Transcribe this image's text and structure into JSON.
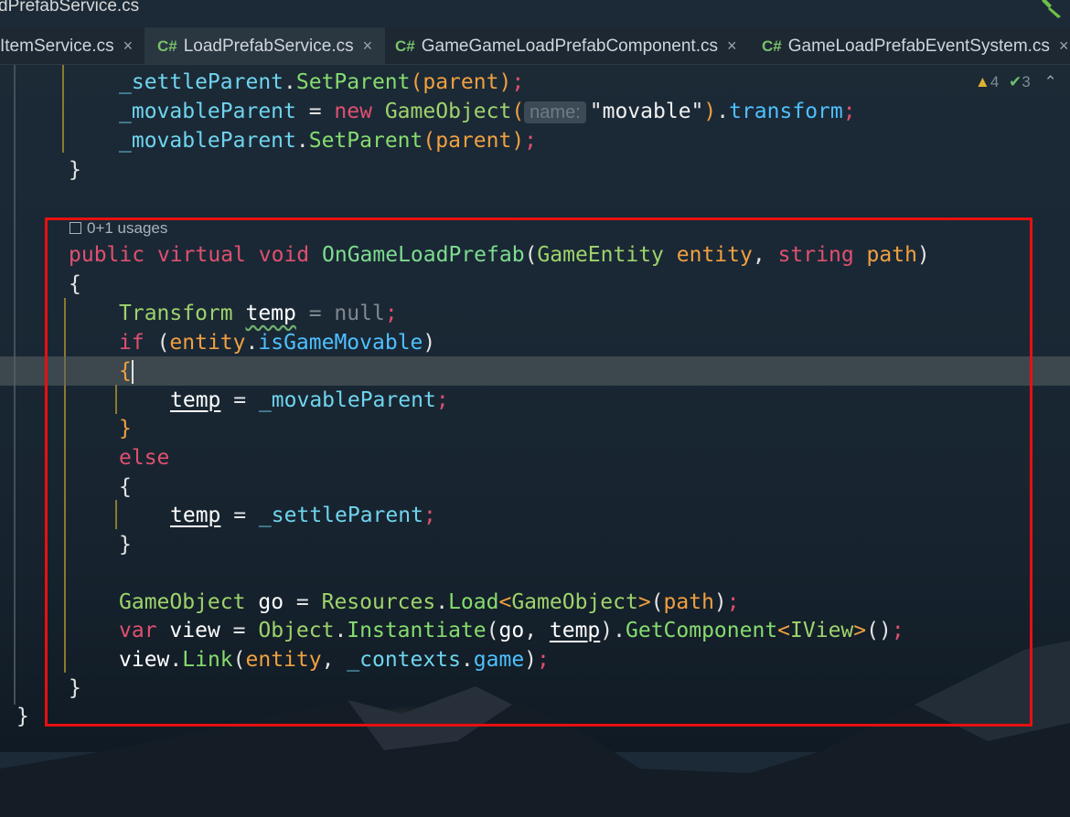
{
  "window": {
    "title": "dPrefabService.cs"
  },
  "tabs": [
    {
      "label": "ItemService.cs",
      "has_cs": false
    },
    {
      "label": "LoadPrefabService.cs",
      "has_cs": true
    },
    {
      "label": "GameGameLoadPrefabComponent.cs",
      "has_cs": true
    },
    {
      "label": "GameLoadPrefabEventSystem.cs",
      "has_cs": true
    }
  ],
  "tab_cs_badge": "C#",
  "tab_close": "×",
  "inspections": {
    "warnings": "4",
    "ok": "3"
  },
  "usages_hint": "0+1 usages",
  "param_hint": "name:",
  "colors": {
    "selection_box": "#e81010",
    "keyword": "#e0506f",
    "type": "#9ed36b",
    "field": "#6fd4ee"
  }
}
